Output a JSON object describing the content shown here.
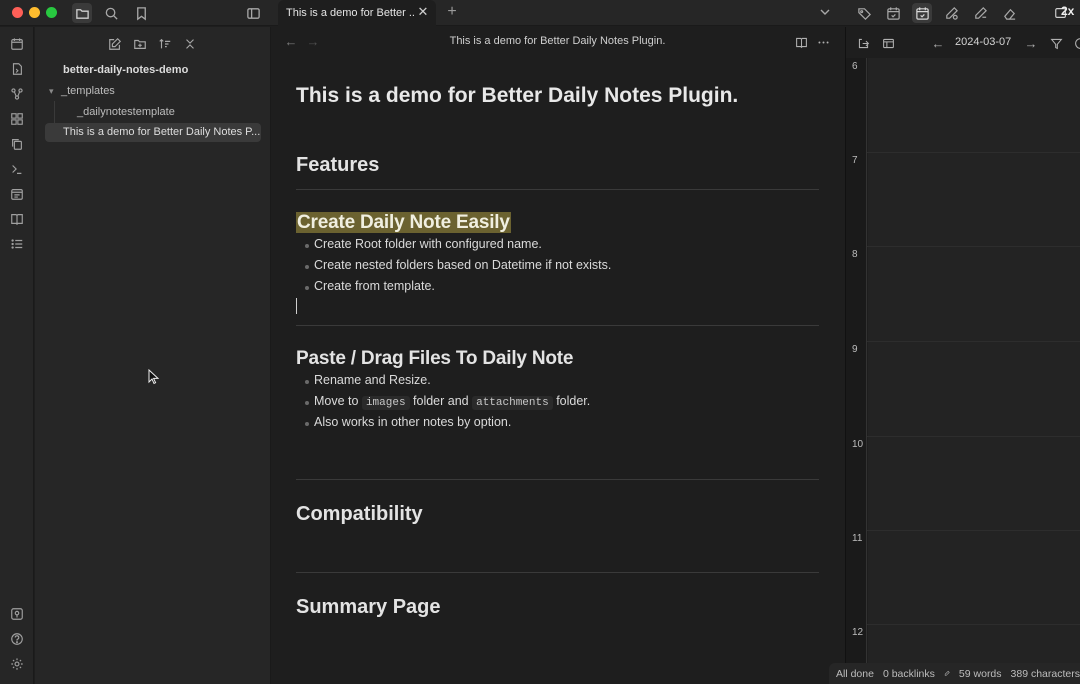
{
  "titlebar": {
    "tab_title": "This is a demo for Better ...",
    "tab_close": "✕",
    "tab_plus": "+",
    "zoom_badge": "2x"
  },
  "sidebar": {
    "vault_name": "better-daily-notes-demo",
    "folder": "_templates",
    "folder_caret": "▾",
    "file_template": "_dailynotestemplate",
    "file_active": "This is a demo for Better Daily Notes P..."
  },
  "editor": {
    "nav_back": "←",
    "nav_forward": "→",
    "view_title": "This is a demo for Better Daily Notes Plugin.",
    "h1": "This is a demo for Better Daily Notes Plugin.",
    "features": "Features",
    "section1": {
      "title": "Create Daily Note Easily",
      "items": [
        "Create Root folder with configured name.",
        "Create nested folders based on Datetime if not exists.",
        "Create from template."
      ]
    },
    "section2": {
      "title": "Paste / Drag Files To Daily Note",
      "item1": "Rename and Resize.",
      "item2_pre": "Move to ",
      "item2_code1": "images",
      "item2_mid": " folder and ",
      "item2_code2": "attachments",
      "item2_post": " folder.",
      "item3": "Also works in other notes by option."
    },
    "compatibility": "Compatibility",
    "summary": "Summary Page"
  },
  "rightpane": {
    "date": "2024-03-07",
    "prev": "←",
    "next": "→",
    "hours": [
      "6",
      "7",
      "8",
      "9",
      "10",
      "11",
      "12"
    ]
  },
  "status": {
    "sync": "All done",
    "backlinks": "0 backlinks",
    "words": "59 words",
    "characters": "389 characters"
  }
}
